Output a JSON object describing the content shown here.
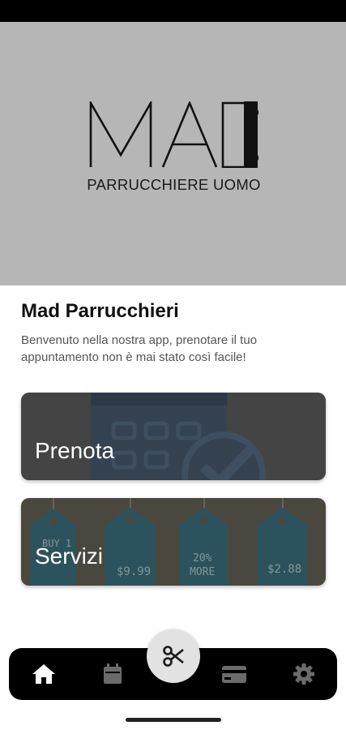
{
  "hero": {
    "logo_text": "MAD",
    "logo_subtitle": "PARRUCCHIERE UOMO"
  },
  "app": {
    "title": "Mad Parrucchieri",
    "description": "Benvenuto nella nostra app, prenotare il tuo appuntamento non è mai stato così facile!"
  },
  "cards": {
    "prenota_label": "Prenota",
    "servizi_label": "Servizi"
  },
  "tags": {
    "tag1": "BUY 1",
    "tag2": "$9.99",
    "tag3_line1": "20%",
    "tag3_line2": "MORE",
    "tag4": "$2.88"
  },
  "nav": {
    "items": [
      "home-icon",
      "calendar-icon",
      "scissors-icon",
      "credit-card-icon",
      "gear-icon"
    ],
    "active": "home-icon",
    "active_color": "#ffffff",
    "inactive_color": "#6b6b6b"
  }
}
